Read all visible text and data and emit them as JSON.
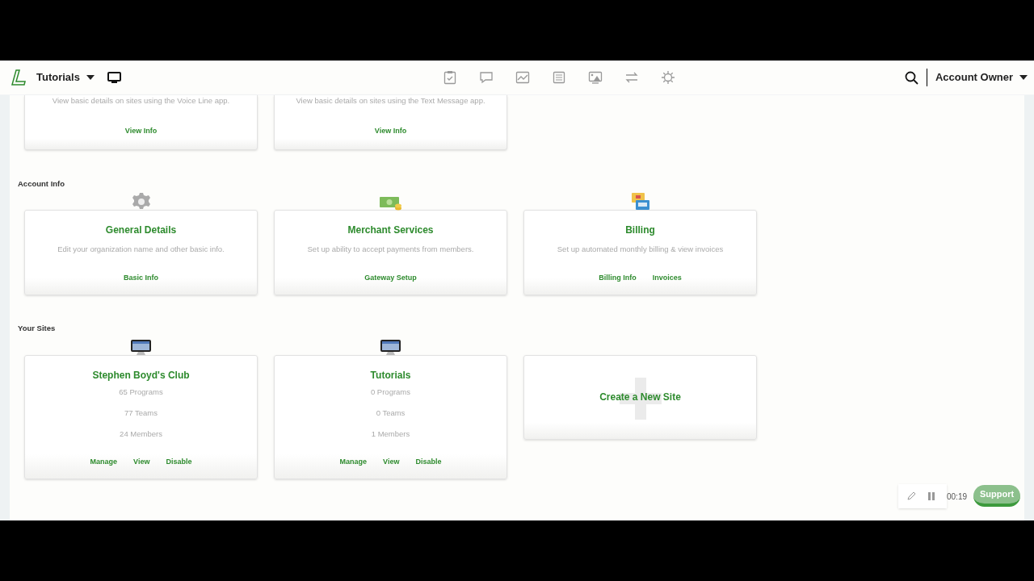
{
  "header": {
    "site_name": "Tutorials",
    "account": "Account Owner"
  },
  "top_cards": [
    {
      "description": "View basic details on sites using the Voice Line app.",
      "links": [
        "View Info"
      ]
    },
    {
      "description": "View basic details on sites using the Text Message app.",
      "links": [
        "View Info"
      ]
    }
  ],
  "sections": [
    {
      "title": "Account Info",
      "cards": [
        {
          "kind": "info",
          "title": "General Details",
          "description": "Edit your organization name and other basic info.",
          "links": [
            "Basic Info"
          ]
        },
        {
          "kind": "info",
          "title": "Merchant Services",
          "description": "Set up ability to accept payments from members.",
          "links": [
            "Gateway Setup"
          ]
        },
        {
          "kind": "info",
          "title": "Billing",
          "description": "Set up automated monthly billing & view invoices",
          "links": [
            "Billing Info",
            "Invoices"
          ]
        }
      ]
    },
    {
      "title": "Your Sites",
      "cards": [
        {
          "kind": "site",
          "title": "Stephen Boyd's Club",
          "stats": [
            "65 Programs",
            "77 Teams",
            "24 Members"
          ],
          "links": [
            "Manage",
            "View",
            "Disable"
          ]
        },
        {
          "kind": "site",
          "title": "Tutorials",
          "stats": [
            "0 Programs",
            "0 Teams",
            "1 Members"
          ],
          "links": [
            "Manage",
            "View",
            "Disable"
          ]
        },
        {
          "kind": "create",
          "title": "Create a New Site"
        }
      ]
    }
  ],
  "recorder": {
    "time": "00:19"
  },
  "support": {
    "label": "Support"
  }
}
